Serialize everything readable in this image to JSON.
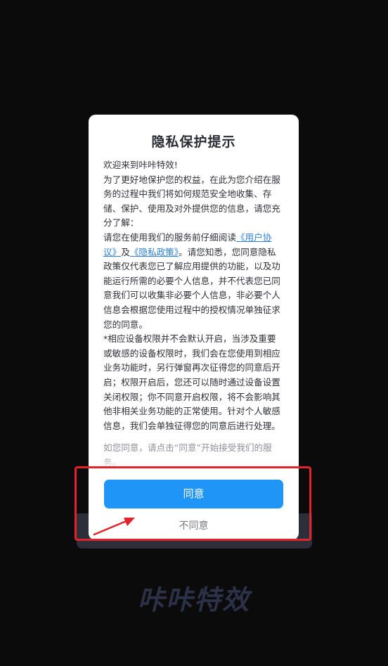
{
  "dialog": {
    "title": "隐私保护提示",
    "body": {
      "p1": "欢迎来到咔咔特效!",
      "p2": "为了更好地保护您的权益，在此为您介绍在服务的过程中我们将如何规范安全地收集、存储、保护、使用及对外提供您的信息，请您充分了解：",
      "p3_prefix": "请您在使用我们的服务前仔细阅读",
      "user_agreement_link": "《用户协议》",
      "and_text": "及",
      "privacy_policy_link": "《隐私政策》",
      "p3_suffix": "。请您知悉，您同意隐私政策仅代表您已了解应用提供的功能，以及功能运行所需的必要个人信息，并不代表您已同意我们可以收集非必要个人信息，非必要个人信息会根据您使用过程中的授权情况单独征求您的同意。",
      "p4": "*相应设备权限并不会默认开启，当涉及重要或敏感的设备权限时，我们会在您使用到相应业务功能时，另行弹窗再次征得您的同意后开启；权限开启后，您还可以随时通过设备设置关闭权限；你不同意开启权限，将不会影响其他非相关业务功能的正常使用。针对个人敏感信息，我们会单独征得您的同意后进行处理。",
      "hint": "如您同意，请点击“同意”开始接受我们的服务。"
    },
    "agree_label": "同意",
    "disagree_label": "不同意"
  },
  "brand": {
    "logo_text": "咔咔特效"
  },
  "colors": {
    "accent": "#1f95f8",
    "link": "#2f7fd8",
    "annotation": "#e2242a",
    "background": "#0b0b0c"
  }
}
